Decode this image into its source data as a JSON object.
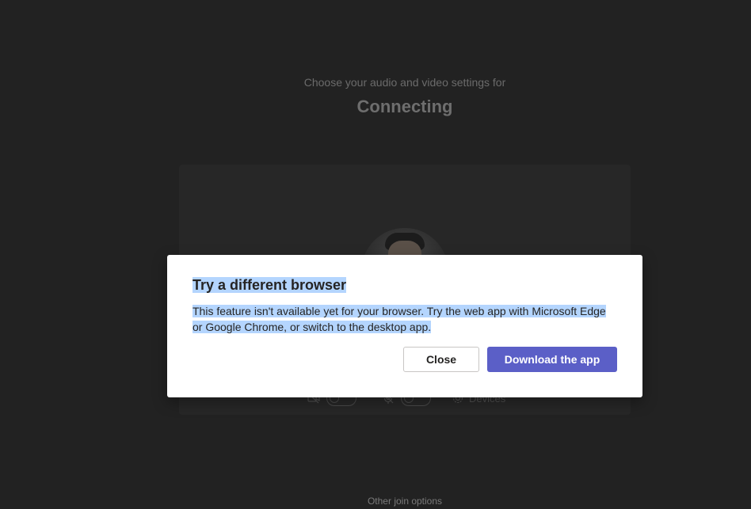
{
  "prejoin": {
    "subtitle": "Choose your audio and video settings for",
    "meeting_title": "Connecting",
    "devices_label": "Devices",
    "other_join_options": "Other join options"
  },
  "dialog": {
    "title": "Try a different browser",
    "body": "This feature isn't available yet for your browser. Try the web app with Microsoft Edge or Google Chrome, or switch to the desktop app.",
    "close_label": "Close",
    "download_label": "Download the app"
  },
  "colors": {
    "background": "#222222",
    "primary_button": "#5b5fc7",
    "selection_highlight": "#b4d5fe"
  },
  "icons": {
    "camera": "camera-off-icon",
    "mic": "mic-off-icon",
    "devices": "gear-icon"
  }
}
